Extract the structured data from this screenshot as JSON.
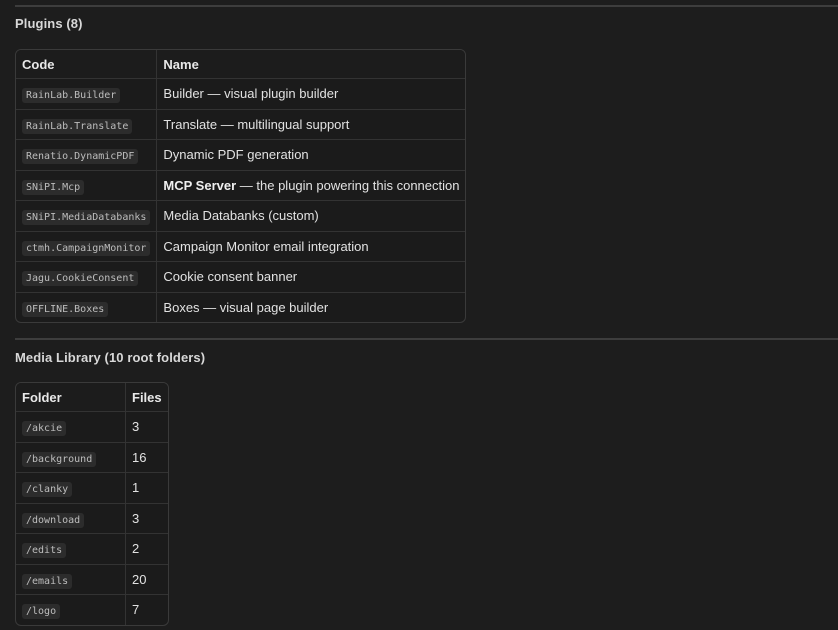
{
  "plugins": {
    "heading": "Plugins (8)",
    "columns": {
      "code": "Code",
      "name": "Name"
    },
    "rows": [
      {
        "code": "RainLab.Builder",
        "name": "Builder — visual plugin builder",
        "strong": "",
        "rest": ""
      },
      {
        "code": "RainLab.Translate",
        "name": "Translate — multilingual support",
        "strong": "",
        "rest": ""
      },
      {
        "code": "Renatio.DynamicPDF",
        "name": "Dynamic PDF generation",
        "strong": "",
        "rest": ""
      },
      {
        "code": "SNiPI.Mcp",
        "name": "",
        "strong": "MCP Server",
        "rest": " — the plugin powering this connection"
      },
      {
        "code": "SNiPI.MediaDatabanks",
        "name": "Media Databanks (custom)",
        "strong": "",
        "rest": ""
      },
      {
        "code": "ctmh.CampaignMonitor",
        "name": "Campaign Monitor email integration",
        "strong": "",
        "rest": ""
      },
      {
        "code": "Jagu.CookieConsent",
        "name": "Cookie consent banner",
        "strong": "",
        "rest": ""
      },
      {
        "code": "OFFLINE.Boxes",
        "name": "Boxes — visual page builder",
        "strong": "",
        "rest": ""
      }
    ]
  },
  "media": {
    "heading": "Media Library (10 root folders)",
    "columns": {
      "folder": "Folder",
      "files": "Files"
    },
    "rows": [
      {
        "folder": "/akcie",
        "files": "3"
      },
      {
        "folder": "/background",
        "files": "16"
      },
      {
        "folder": "/clanky",
        "files": "1"
      },
      {
        "folder": "/download",
        "files": "3"
      },
      {
        "folder": "/edits",
        "files": "2"
      },
      {
        "folder": "/emails",
        "files": "20"
      },
      {
        "folder": "/logo",
        "files": "7"
      }
    ]
  }
}
